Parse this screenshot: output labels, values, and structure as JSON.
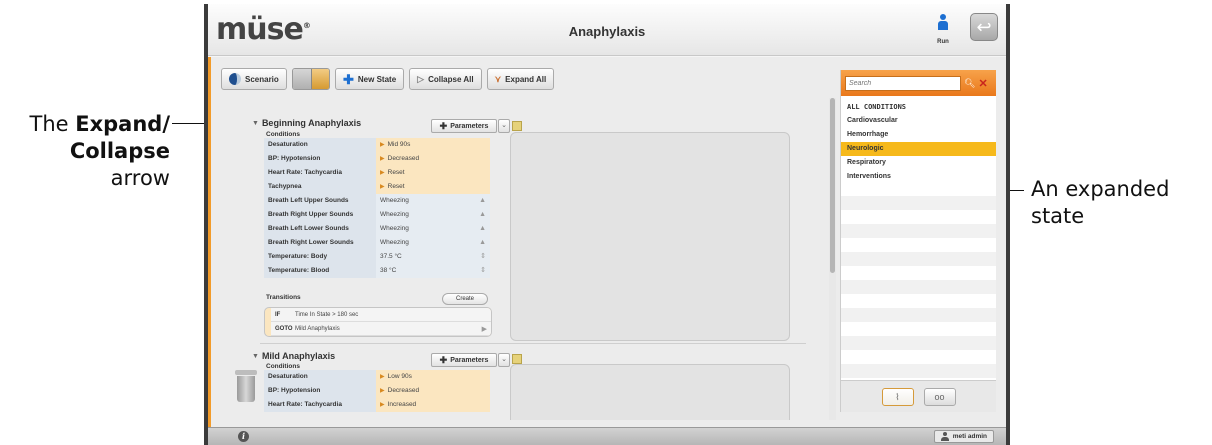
{
  "callouts": {
    "left_prefix": "The ",
    "left_bold": "Expand/ Collapse",
    "left_suffix": "arrow",
    "right": "An expanded state"
  },
  "app": {
    "logo": "müse",
    "logo_reg": "®",
    "title": "Anaphylaxis",
    "run_label": "Run"
  },
  "toolbar": {
    "scenario": "Scenario",
    "new_state": "New State",
    "collapse_all": "Collapse All",
    "expand_all": "Expand All"
  },
  "states": [
    {
      "title": "Beginning Anaphylaxis",
      "conditions_label": "Conditions",
      "parameters_label": "Parameters",
      "conditions": [
        {
          "name": "Desaturation",
          "value": "Mid 90s",
          "kind": "orange"
        },
        {
          "name": "BP: Hypotension",
          "value": "Decreased",
          "kind": "orange"
        },
        {
          "name": "Heart Rate: Tachycardia",
          "value": "Reset",
          "kind": "orange"
        },
        {
          "name": "Tachypnea",
          "value": "Reset",
          "kind": "orange"
        },
        {
          "name": "Breath Left Upper Sounds",
          "value": "Wheezing",
          "kind": "blue"
        },
        {
          "name": "Breath Right Upper Sounds",
          "value": "Wheezing",
          "kind": "blue"
        },
        {
          "name": "Breath Left Lower Sounds",
          "value": "Wheezing",
          "kind": "blue"
        },
        {
          "name": "Breath Right Lower Sounds",
          "value": "Wheezing",
          "kind": "blue"
        },
        {
          "name": "Temperature: Body",
          "value": "37.5 °C",
          "kind": "blue"
        },
        {
          "name": "Temperature: Blood",
          "value": "38 °C",
          "kind": "blue"
        }
      ],
      "transitions_label": "Transitions",
      "create_label": "Create",
      "transition": {
        "if_label": "IF",
        "if_value": "Time In State > 180 sec",
        "goto_label": "GOTO",
        "goto_value": "Mild Anaphylaxis"
      }
    },
    {
      "title": "Mild Anaphylaxis",
      "conditions_label": "Conditions",
      "parameters_label": "Parameters",
      "conditions": [
        {
          "name": "Desaturation",
          "value": "Low 90s",
          "kind": "orange"
        },
        {
          "name": "BP: Hypotension",
          "value": "Decreased",
          "kind": "orange"
        },
        {
          "name": "Heart Rate: Tachycardia",
          "value": "Increased",
          "kind": "orange"
        }
      ]
    }
  ],
  "sidebar": {
    "search_placeholder": "Search",
    "categories": [
      "ALL CONDITIONS",
      "Cardiovascular",
      "Hemorrhage",
      "Neurologic",
      "Respiratory",
      "Interventions"
    ],
    "selected": "Neurologic"
  },
  "status": {
    "user": "meti admin"
  },
  "colors": {
    "accent": "#f29b2a",
    "selected_category": "#f6b91b",
    "brand_blue": "#1d6fd1"
  }
}
